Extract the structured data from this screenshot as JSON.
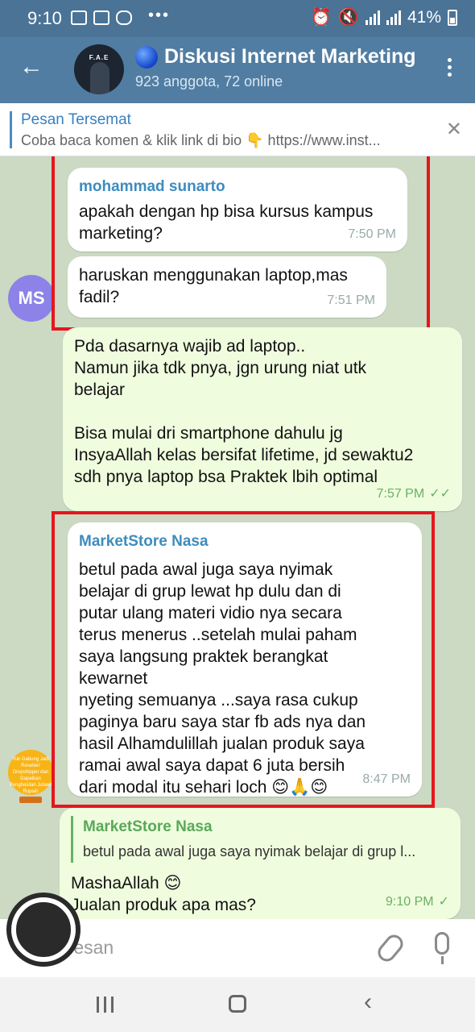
{
  "status_bar": {
    "time": "9:10",
    "battery": "41%"
  },
  "header": {
    "avatar_text": "F.A.E",
    "title": "Diskusi Internet Marketing",
    "subtitle": "923 anggota, 72 online"
  },
  "pinned": {
    "title": "Pesan Tersemat",
    "text": "Coba baca komen & klik link di bio 👇  https://www.inst..."
  },
  "messages": [
    {
      "sender": "mohammad sunarto",
      "text": "apakah dengan hp bisa kursus kampus\nmarketing?",
      "time": "7:50 PM"
    },
    {
      "text": "haruskan menggunakan laptop,mas\nfadil?",
      "time": "7:51 PM",
      "avatar": "MS"
    },
    {
      "text": "Pda dasarnya wajib ad laptop..\nNamun jika tdk pnya, jgn urung niat utk\nbelajar\n\nBisa mulai dri smartphone dahulu jg\nInsyaAllah kelas bersifat lifetime, jd sewaktu2\nsdh pnya laptop bsa Praktek lbih optimal",
      "time": "7:57 PM",
      "check": "✓✓"
    },
    {
      "sender": "MarketStore Nasa",
      "text": "betul pada awal juga saya nyimak\nbelajar di grup lewat hp dulu dan di\nputar ulang materi vidio nya secara\nterus menerus ..setelah mulai paham\nsaya langsung praktek berangkat\nkewarnet\nnyeting semuanya ...saya rasa cukup\npaginya baru saya star fb ads nya dan\nhasil Alhamdulillah jualan produk saya\nramai awal saya dapat 6 juta bersih\ndari modal itu sehari loch 😊🙏😊",
      "time": "8:47 PM",
      "avatar_text": "Yuk Gabung Jadi Reseller/ Dropshipper dan Dapatkan Penghasilan Jutaan Rupiah"
    },
    {
      "reply_name": "MarketStore Nasa",
      "reply_text": "betul pada awal juga saya nyimak belajar di grup l...",
      "text": "MashaAllah 😊\nJualan produk apa mas?",
      "time": "9:10 PM",
      "check": "✓"
    }
  ],
  "input": {
    "placeholder": "Pesan"
  }
}
